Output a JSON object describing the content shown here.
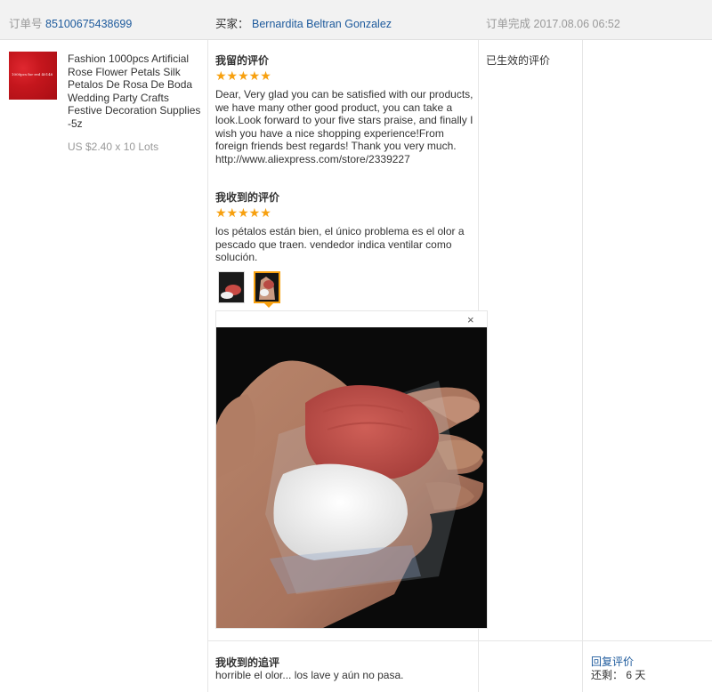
{
  "header": {
    "order_label": "订单号",
    "order_number": "85100675438699",
    "buyer_label": "买家：",
    "buyer_name": "Bernardita Beltran Gonzalez",
    "completed_label": "订单完成",
    "completed_time": "2017.08.06 06:52"
  },
  "product": {
    "thumb_text": "1000pcs for red 40148",
    "title": "Fashion 1000pcs Artificial Rose Flower Petals Silk Petalos De Rosa De Boda Wedding Party Crafts Festive Decoration Supplies -5z",
    "price": "US $2.40 x 10 Lots"
  },
  "status_text": "已生效的评价",
  "my_review": {
    "heading": "我留的评价",
    "stars": "★★★★★",
    "text": "Dear, Very glad you can be satisfied with our products, we have many other good product, you can take a look.Look forward to your five stars praise, and finally I wish you have a nice shopping experience!From foreign friends best regards! Thank you very much.",
    "link": "http://www.aliexpress.com/store/2339227"
  },
  "received_review": {
    "heading": "我收到的评价",
    "stars": "★★★★★",
    "text": "los pétalos están bien, el único problema es el olor a pescado que traen. vendedor indica ventilar como solución."
  },
  "preview": {
    "close": "×"
  },
  "followup": {
    "heading": "我收到的追评",
    "text": "horrible el olor... los lave y aún no pasa.",
    "reply_label": "回复评价",
    "remain_label": "还剩：",
    "remain_value": "6 天"
  },
  "colors": {
    "link": "#1d5a9c",
    "star": "#f7a00f",
    "header_bg": "#f2f2f2"
  }
}
